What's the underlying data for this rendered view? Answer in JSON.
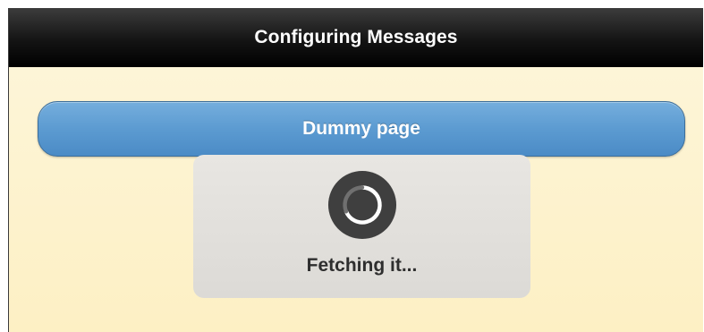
{
  "header": {
    "title": "Configuring Messages"
  },
  "main": {
    "button_label": "Dummy page"
  },
  "loader": {
    "message": "Fetching it...",
    "icon": "spinner-icon"
  },
  "colors": {
    "header_bg": "#141414",
    "page_bg": "#fdf3cf",
    "button_bg": "#5c9bd1",
    "loader_bg": "#e2e0dc",
    "spinner": "#3f3f3f"
  }
}
